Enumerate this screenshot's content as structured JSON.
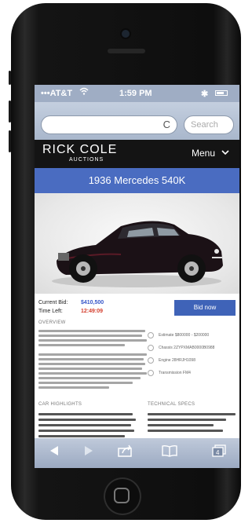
{
  "status_bar": {
    "carrier": "AT&T",
    "wifi_icon": "wifi-icon",
    "time": "1:59 PM",
    "bluetooth": "✱"
  },
  "browser": {
    "url": "",
    "reload_icon": "C",
    "search_placeholder": "Search"
  },
  "site": {
    "logo_line1": "RICK COLE",
    "logo_line2": "AUCTIONS",
    "menu_label": "Menu",
    "menu_icon": "chevron-down-icon"
  },
  "lot": {
    "title": "1936 Mercedes 540K"
  },
  "bidding": {
    "current_bid_label": "Current Bid:",
    "current_bid_value": "$410,500",
    "time_left_label": "Time Left:",
    "time_left_value": "12:49:09",
    "bid_button": "Bid now"
  },
  "overview": {
    "heading": "OVERVIEW"
  },
  "specs": [
    {
      "icon": "estimate-icon",
      "text": "Estimate $800000 - $200000"
    },
    {
      "icon": "chassis-icon",
      "text": "Chassis 2ZYPXMAB0000B0988"
    },
    {
      "icon": "engine-icon",
      "text": "Engine 28HRJH1098"
    },
    {
      "icon": "transmission-icon",
      "text": "Transmission FM4"
    }
  ],
  "car_highlights": {
    "heading": "CAR HIGHLIGHTS"
  },
  "technical_specs": {
    "heading": "TECHNICAL SPECS"
  },
  "toolbar": [
    "back-icon",
    "share-icon",
    "bookmarks-icon",
    "tabs-icon"
  ],
  "colors": {
    "header_bg": "#141414",
    "title_bar": "#4a6cc1",
    "bid_value": "#3555c8",
    "time_value": "#d43d2c"
  }
}
